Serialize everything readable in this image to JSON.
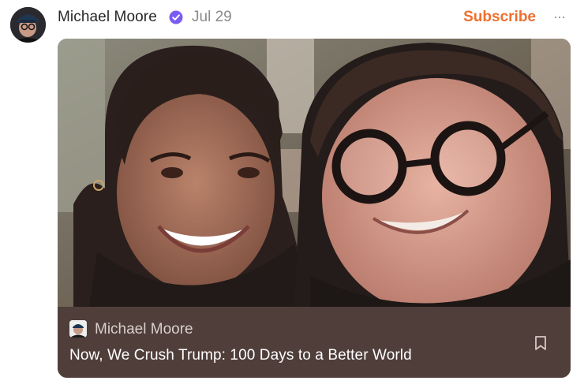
{
  "author": {
    "name": "Michael Moore",
    "verified": true,
    "date": "Jul 29"
  },
  "actions": {
    "subscribe_label": "Subscribe",
    "more_label": "···"
  },
  "card": {
    "publication_name": "Michael Moore",
    "title": "Now, We Crush Trump: 100 Days to a Better World"
  },
  "colors": {
    "accent": "#ee6f2d",
    "verified_badge": "#7b5cf0",
    "card_footer": "#4f3e3a"
  }
}
